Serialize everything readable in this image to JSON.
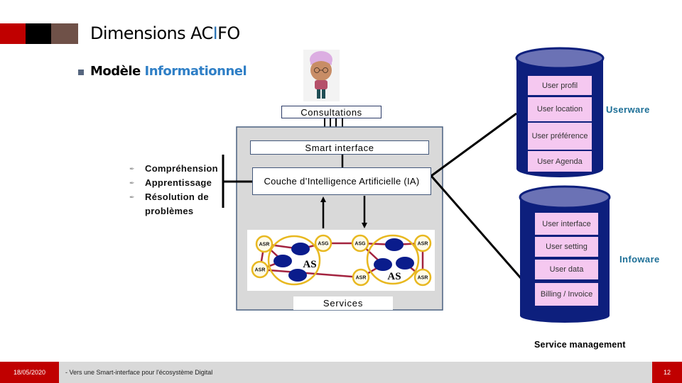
{
  "header": {
    "title_prefix": "Dimensions AC",
    "title_highlight": "I",
    "title_suffix": "FO",
    "subtitle_prefix": "Modèle ",
    "subtitle_highlight": "Informationnel"
  },
  "diagram": {
    "consultations": "Consultations",
    "smart_interface": "Smart interface",
    "ai_layer": "Couche d’Intelligence Artificielle (IA)",
    "services": "Services",
    "capabilities": [
      "Compréhension",
      "Apprentissage",
      "Résolution de problèmes"
    ],
    "capability_bullet_icon": "pen-icon",
    "services_graph": {
      "nodes": [
        "ASR",
        "ASR",
        "ASG",
        "ASG",
        "ASR",
        "ASR",
        "ASR"
      ],
      "clusters": [
        "AS",
        "AS"
      ]
    }
  },
  "userware": {
    "label": "Userware",
    "items": [
      "User profil",
      "User location",
      "User préférence",
      "User Agenda"
    ]
  },
  "infoware": {
    "label": "Infoware",
    "items": [
      "User interface",
      "User setting",
      "User data",
      "Billing / Invoice"
    ]
  },
  "service_management": "Service management",
  "footer": {
    "date": "18/05/2020",
    "text": "- Vers une Smart-interface pour l'écosystème Digital",
    "page": "12"
  },
  "colors": {
    "accent_red": "#c00000",
    "accent_blue": "#2e75b6",
    "ware_label": "#1b6e96",
    "cylinder_body": "#0d1f7d",
    "cylinder_top": "#6b72b5",
    "cylinder_item": "#f5c8f0",
    "graph_edge": "#a3233f",
    "graph_node_ring": "#e8b820",
    "graph_agent": "#0a1c8c"
  }
}
